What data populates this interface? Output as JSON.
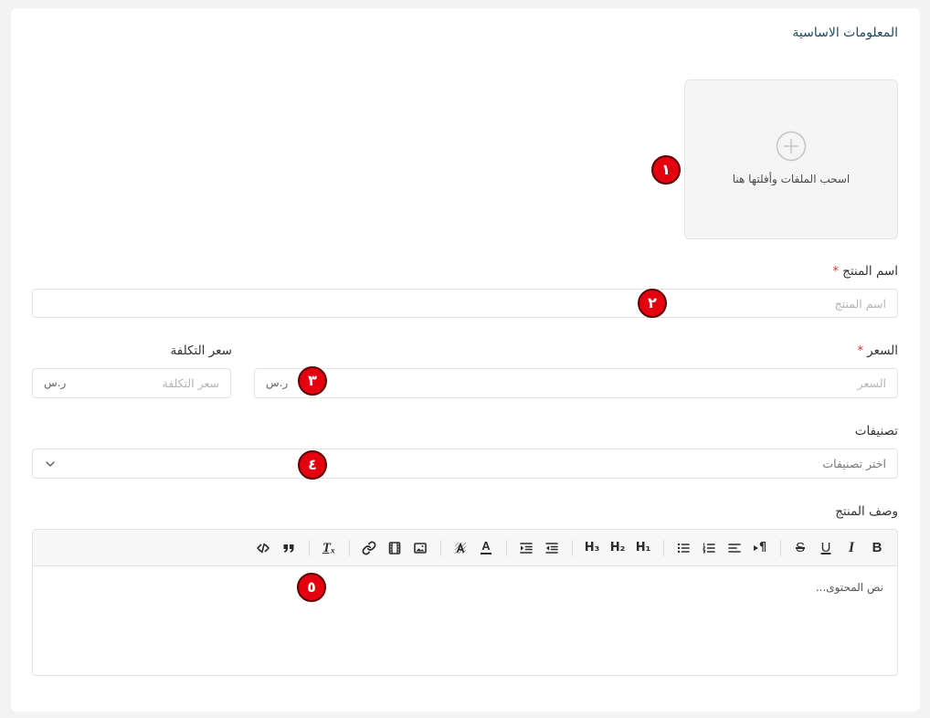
{
  "colors": {
    "page_background": "#f3f3f3",
    "card_background": "#ffffff",
    "title": "#1e4b5a",
    "required_mark": "#e53935",
    "badge": "#e4000f",
    "border": "#e3e3e3"
  },
  "section": {
    "title": "المعلومات الاساسية"
  },
  "dropzone": {
    "icon": "plus-circle-icon",
    "text": "اسحب الملفات وأفلتها هنا"
  },
  "annotation_badges": [
    "١",
    "٢",
    "٣",
    "٤",
    "٥"
  ],
  "fields": {
    "name": {
      "label": "اسم المنتج",
      "required_mark": "*",
      "placeholder": "اسم المنتج"
    },
    "price": {
      "label": "السعر",
      "required_mark": "*",
      "placeholder": "السعر",
      "suffix": "ر.س"
    },
    "cost": {
      "label": "سعر التكلفة",
      "placeholder": "سعر التكلفة",
      "suffix": "ر.س"
    },
    "categories": {
      "label": "تصنيفات",
      "placeholder": "اختر تصنيفات",
      "icon": "chevron-down-icon"
    },
    "description": {
      "label": "وصف المنتج",
      "placeholder": "نص المحتوى...",
      "toolbar": {
        "bold": {
          "icon": "bold-icon",
          "glyph": "B"
        },
        "italic": {
          "icon": "italic-icon",
          "glyph": "I"
        },
        "underline": {
          "icon": "underline-icon",
          "glyph": "U"
        },
        "strike": {
          "icon": "strikethrough-icon",
          "glyph": "S"
        },
        "direction": {
          "icon": "text-direction-icon",
          "glyph": "¶"
        },
        "align": {
          "icon": "align-icon"
        },
        "ordered_list": {
          "icon": "ordered-list-icon"
        },
        "bullet_list": {
          "icon": "bullet-list-icon"
        },
        "h1": {
          "icon": "heading-1-icon",
          "glyph": "H₁"
        },
        "h2": {
          "icon": "heading-2-icon",
          "glyph": "H₂"
        },
        "h3": {
          "icon": "heading-3-icon",
          "glyph": "H₃"
        },
        "indent_decrease": {
          "icon": "outdent-icon"
        },
        "indent_increase": {
          "icon": "indent-icon"
        },
        "font_color": {
          "icon": "font-color-icon",
          "glyph": "A"
        },
        "background_color": {
          "icon": "background-color-icon"
        },
        "image": {
          "icon": "image-icon"
        },
        "video": {
          "icon": "video-icon"
        },
        "link": {
          "icon": "link-icon"
        },
        "clean": {
          "icon": "clear-format-icon",
          "glyph": "Tₓ"
        },
        "blockquote": {
          "icon": "blockquote-icon"
        },
        "code_block": {
          "icon": "code-icon"
        }
      }
    }
  }
}
